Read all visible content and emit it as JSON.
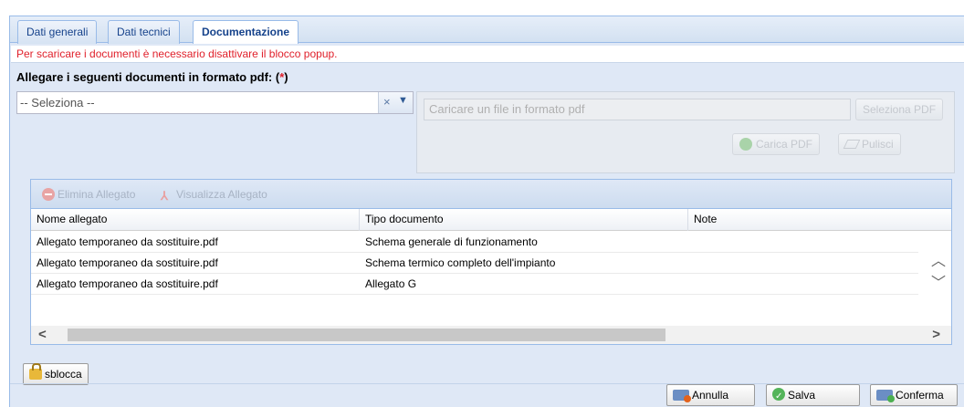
{
  "tabs": [
    {
      "label": "Dati generali",
      "active": false
    },
    {
      "label": "Dati tecnici",
      "active": false
    },
    {
      "label": "Documentazione",
      "active": true
    }
  ],
  "warning": "Per scaricare i documenti è necessario disattivare il blocco popup.",
  "attach": {
    "label": "Allegare i seguenti documenti in formato pdf: (",
    "required_star": "*",
    "label_end": ")",
    "combo_value": "-- Seleziona --",
    "clear_icon": "×",
    "dropdown_icon": "▼"
  },
  "upload": {
    "placeholder": "Caricare un file in formato pdf",
    "select_button": "Seleziona PDF",
    "upload_button": "Carica PDF",
    "clear_button": "Pulisci"
  },
  "grid": {
    "toolbar": {
      "delete_label": "Elimina Allegato",
      "view_label": "Visualizza Allegato"
    },
    "columns": [
      "Nome allegato",
      "Tipo documento",
      "Note"
    ],
    "rows": [
      {
        "name": "Allegato temporaneo da sostituire.pdf",
        "type": "Schema generale di funzionamento",
        "note": ""
      },
      {
        "name": "Allegato temporaneo da sostituire.pdf",
        "type": "Schema termico completo dell'impianto",
        "note": ""
      },
      {
        "name": "Allegato temporaneo da sostituire.pdf",
        "type": "Allegato G",
        "note": ""
      }
    ]
  },
  "unlock_button": "sblocca",
  "footer": {
    "cancel": "Annulla",
    "save": "Salva",
    "confirm": "Conferma"
  }
}
